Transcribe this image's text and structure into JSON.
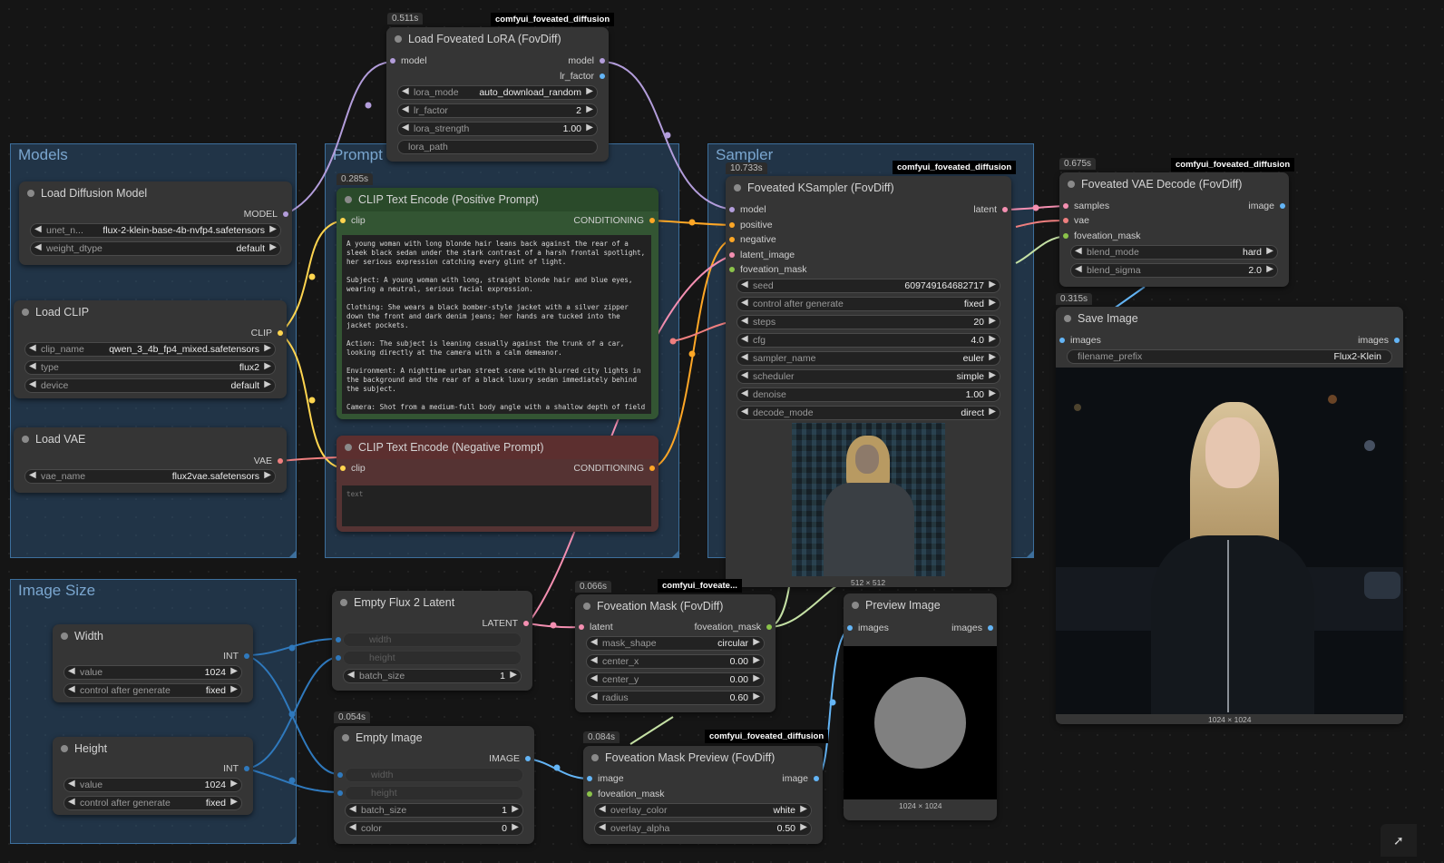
{
  "groups": {
    "models": "Models",
    "prompt": "Prompt",
    "sampler": "Sampler",
    "image_size": "Image Size"
  },
  "badge": "comfyui_foveated_diffusion",
  "badge_short": "comfyui_foveate...",
  "nodes": {
    "lora": {
      "title": "Load Foveated LoRA (FovDiff)",
      "timing": "0.511s",
      "in_model": "model",
      "out_model": "model",
      "out_lr": "lr_factor",
      "w_mode_label": "lora_mode",
      "w_mode_value": "auto_download_random",
      "w_lr_label": "lr_factor",
      "w_lr_value": "2",
      "w_str_label": "lora_strength",
      "w_str_value": "1.00",
      "w_path_label": "lora_path"
    },
    "diffusion": {
      "title": "Load Diffusion Model",
      "out": "MODEL",
      "w1_label": "unet_n...",
      "w1_value": "flux-2-klein-base-4b-nvfp4.safetensors",
      "w2_label": "weight_dtype",
      "w2_value": "default"
    },
    "clip": {
      "title": "Load CLIP",
      "out": "CLIP",
      "w1_label": "clip_name",
      "w1_value": "qwen_3_4b_fp4_mixed.safetensors",
      "w2_label": "type",
      "w2_value": "flux2",
      "w3_label": "device",
      "w3_value": "default"
    },
    "vae": {
      "title": "Load VAE",
      "out": "VAE",
      "w1_label": "vae_name",
      "w1_value": "flux2vae.safetensors"
    },
    "pos": {
      "title": "CLIP Text Encode (Positive Prompt)",
      "timing": "0.285s",
      "in": "clip",
      "out": "CONDITIONING",
      "text": "A young woman with long blonde hair leans back against the rear of a sleek black sedan under the stark contrast of a harsh frontal spotlight, her serious expression catching every glint of light.\n\nSubject: A young woman with long, straight blonde hair and blue eyes, wearing a neutral, serious facial expression.\n\nClothing: She wears a black bomber-style jacket with a silver zipper down the front and dark denim jeans; her hands are tucked into the jacket pockets.\n\nAction: The subject is leaning casually against the trunk of a car, looking directly at the camera with a calm demeanor.\n\nEnvironment: A nighttime urban street scene with blurred city lights in the background and the rear of a black luxury sedan immediately behind the subject.\n\nCamera: Shot from a medium-full body angle with a shallow depth of field"
    },
    "neg": {
      "title": "CLIP Text Encode (Negative Prompt)",
      "in": "clip",
      "out": "CONDITIONING",
      "placeholder": "text"
    },
    "ksampler": {
      "title": "Foveated KSampler (FovDiff)",
      "timing": "10.733s",
      "in_model": "model",
      "in_pos": "positive",
      "in_neg": "negative",
      "in_latent": "latent_image",
      "in_mask": "foveation_mask",
      "out": "latent",
      "widgets": [
        {
          "label": "seed",
          "value": "609749164682717"
        },
        {
          "label": "control after generate",
          "value": "fixed"
        },
        {
          "label": "steps",
          "value": "20"
        },
        {
          "label": "cfg",
          "value": "4.0"
        },
        {
          "label": "sampler_name",
          "value": "euler"
        },
        {
          "label": "scheduler",
          "value": "simple"
        },
        {
          "label": "denoise",
          "value": "1.00"
        },
        {
          "label": "decode_mode",
          "value": "direct"
        }
      ],
      "preview_size": "512 × 512"
    },
    "vaedecode": {
      "title": "Foveated VAE Decode (FovDiff)",
      "timing": "0.675s",
      "in1": "samples",
      "in2": "vae",
      "in3": "foveation_mask",
      "out": "image",
      "w1_label": "blend_mode",
      "w1_value": "hard",
      "w2_label": "blend_sigma",
      "w2_value": "2.0"
    },
    "save": {
      "title": "Save Image",
      "timing": "0.315s",
      "in": "images",
      "out": "images",
      "w1_label": "filename_prefix",
      "w1_value": "Flux2-Klein",
      "size": "1024 × 1024"
    },
    "width": {
      "title": "Width",
      "out": "INT",
      "w1_label": "value",
      "w1_value": "1024",
      "w2_label": "control after generate",
      "w2_value": "fixed"
    },
    "height": {
      "title": "Height",
      "out": "INT",
      "w1_label": "value",
      "w1_value": "1024",
      "w2_label": "control after generate",
      "w2_value": "fixed"
    },
    "latent": {
      "title": "Empty Flux 2 Latent",
      "out": "LATENT",
      "w1": "width",
      "w2": "height",
      "w3_label": "batch_size",
      "w3_value": "1"
    },
    "emptyimg": {
      "title": "Empty Image",
      "timing": "0.054s",
      "out": "IMAGE",
      "w1": "width",
      "w2": "height",
      "w3_label": "batch_size",
      "w3_value": "1",
      "w4_label": "color",
      "w4_value": "0"
    },
    "mask": {
      "title": "Foveation Mask (FovDiff)",
      "timing": "0.066s",
      "in": "latent",
      "out": "foveation_mask",
      "w1_label": "mask_shape",
      "w1_value": "circular",
      "w2_label": "center_x",
      "w2_value": "0.00",
      "w3_label": "center_y",
      "w3_value": "0.00",
      "w4_label": "radius",
      "w4_value": "0.60"
    },
    "maskprev": {
      "title": "Foveation Mask Preview (FovDiff)",
      "timing": "0.084s",
      "in1": "image",
      "in2": "foveation_mask",
      "out": "image",
      "w1_label": "overlay_color",
      "w1_value": "white",
      "w2_label": "overlay_alpha",
      "w2_value": "0.50"
    },
    "preview": {
      "title": "Preview Image",
      "in": "images",
      "out": "images",
      "size": "1024 × 1024"
    }
  }
}
